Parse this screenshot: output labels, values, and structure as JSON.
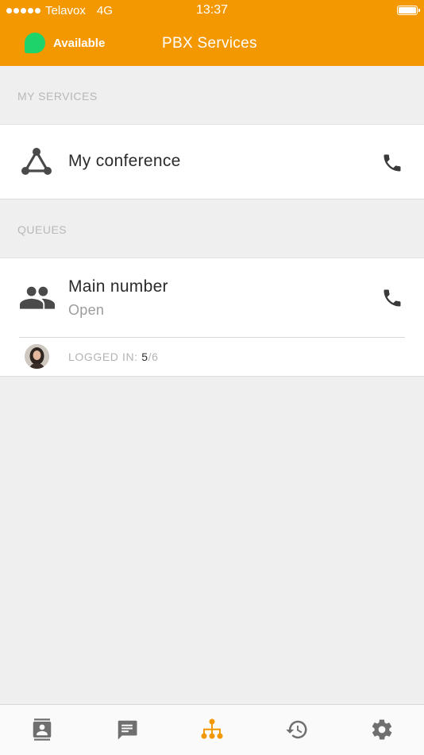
{
  "status_bar": {
    "carrier": "Telavox",
    "network": "4G",
    "time": "13:37"
  },
  "header": {
    "presence_label": "Available",
    "title": "PBX Services"
  },
  "sections": {
    "my_services": {
      "header": "MY SERVICES",
      "items": [
        {
          "title": "My conference",
          "icon": "conference-icon",
          "action_icon": "phone-icon"
        }
      ]
    },
    "queues": {
      "header": "QUEUES",
      "items": [
        {
          "title": "Main number",
          "status": "Open",
          "icon": "group-icon",
          "action_icon": "phone-icon",
          "logged_in_label": "LOGGED IN:",
          "logged_in_count": "5",
          "logged_in_total": "/6"
        }
      ]
    }
  },
  "tabbar": {
    "tabs": [
      {
        "name": "contacts",
        "icon": "contacts-icon",
        "active": false
      },
      {
        "name": "messages",
        "icon": "chat-icon",
        "active": false
      },
      {
        "name": "pbx-services",
        "icon": "org-chart-icon",
        "active": true
      },
      {
        "name": "history",
        "icon": "history-icon",
        "active": false
      },
      {
        "name": "settings",
        "icon": "gear-icon",
        "active": false
      }
    ]
  },
  "colors": {
    "brand": "#f39800",
    "presence": "#1fd36b",
    "icon": "#4a4a4a",
    "tab_inactive": "#6f6f6f",
    "tab_active": "#f39800"
  }
}
